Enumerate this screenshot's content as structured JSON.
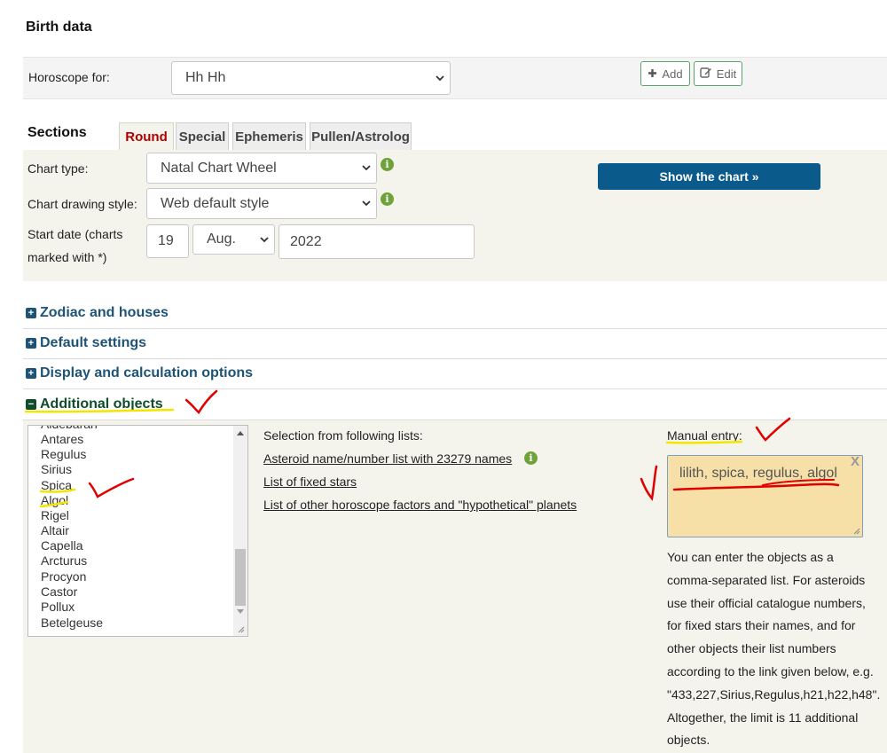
{
  "birth_data": {
    "title": "Birth data",
    "horoscope_label": "Horoscope for:",
    "horoscope_value": "Hh Hh",
    "add_label": "Add",
    "edit_label": "Edit"
  },
  "sections": {
    "label": "Sections",
    "tabs": [
      {
        "label": "Round",
        "active": true
      },
      {
        "label": "Special"
      },
      {
        "label": "Ephemeris"
      },
      {
        "label": "Pullen/Astrolog"
      }
    ]
  },
  "form": {
    "chart_type_label": "Chart type:",
    "chart_type_value": "Natal Chart Wheel",
    "drawing_style_label": "Chart drawing style:",
    "drawing_style_value": "Web default style",
    "start_date_label_1": "Start date (charts",
    "start_date_label_2": "marked with *)",
    "day": "19",
    "month": "Aug.",
    "year": "2022",
    "info_glyph": "i",
    "show_chart_label": "Show the chart »"
  },
  "accordions": [
    {
      "label": "Zodiac and houses",
      "icon": "plus-square-icon"
    },
    {
      "label": "Default settings",
      "icon": "plus-square-icon"
    },
    {
      "label": "Display and calculation options",
      "icon": "plus-square-icon"
    },
    {
      "label": "Additional objects",
      "icon": "minus-square-icon"
    }
  ],
  "objects": {
    "star_list": [
      "Aldebaran",
      "Antares",
      "Regulus",
      "Sirius",
      "Spica",
      "Algol",
      "Rigel",
      "Altair",
      "Capella",
      "Arcturus",
      "Procyon",
      "Castor",
      "Pollux",
      "Betelgeuse"
    ],
    "selection_heading": "Selection from following lists:",
    "asteroid_link": "Asteroid name/number list with 23279 names",
    "fixed_stars_link": "List of fixed stars",
    "other_factors_link": "List of other horoscope factors and \"hypothetical\" planets",
    "manual_label": "Manual entry:",
    "manual_value": "lilith, spica, regulus, algol",
    "clear_label": "X",
    "help_lines": [
      "You can enter the objects as a",
      "comma-separated list. For asteroids",
      "use their official catalogue numbers,",
      "for fixed stars their names, and for",
      "other objects their list numbers",
      "according to the link given below, e.g.",
      "\"433,227,Sirius,Regulus,h21,h22,h48\".",
      "Altogether, the limit is 11 additional",
      "objects."
    ]
  },
  "colors": {
    "accent_blue": "#0a5a8c",
    "section_blue": "#1d5476",
    "active_tab_red": "#b00000",
    "manual_box_bg": "#f7dfa8",
    "annotation_red": "#e00000",
    "highlight_yellow": "#f2e600"
  }
}
